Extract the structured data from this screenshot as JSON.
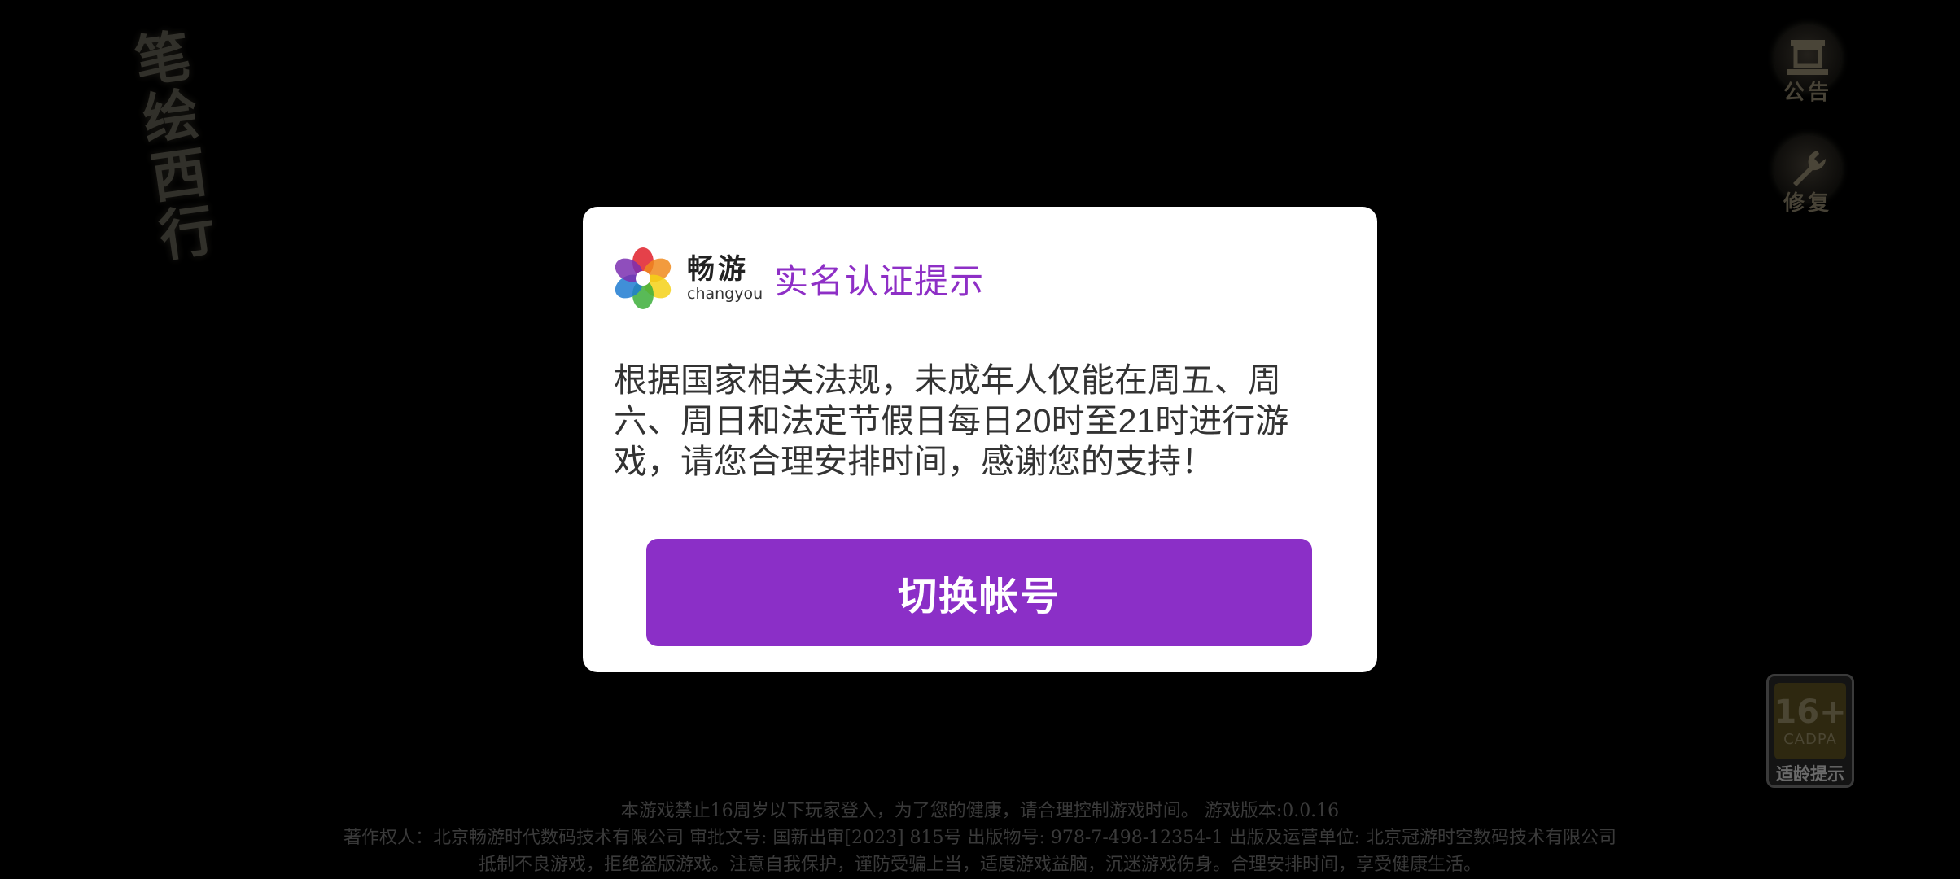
{
  "background": {
    "game_logo_chars": [
      "笔",
      "绘",
      "西",
      "行"
    ]
  },
  "side_buttons": {
    "announcement_label": "公告",
    "repair_label": "修复"
  },
  "age_rating": {
    "age": "16+",
    "org": "CADPA",
    "tip": "适龄提示"
  },
  "dialog": {
    "brand_cn": "畅游",
    "brand_en": "changyou",
    "title": "实名认证提示",
    "message": "根据国家相关法规，未成年人仅能在周五、周六、周日和法定节假日每日20时至21时进行游戏，请您合理安排时间，感谢您的支持！",
    "button_label": "切换帐号",
    "brand_colors": [
      "#e0202a",
      "#f08a1c",
      "#f4d116",
      "#3cae3a",
      "#1f7bd1",
      "#7b2fb0"
    ]
  },
  "footer": {
    "line1": "本游戏禁止16周岁以下玩家登入，为了您的健康，请合理控制游戏时间。 游戏版本:0.0.16",
    "line2": "著作权人：北京畅游时代数码技术有限公司 审批文号: 国新出审[2023] 815号 出版物号: 978-7-498-12354-1 出版及运营单位: 北京冠游时空数码技术有限公司",
    "line3": "抵制不良游戏，拒绝盗版游戏。注意自我保护，谨防受骗上当，适度游戏益脑，沉迷游戏伤身。合理安排时间，享受健康生活。"
  }
}
